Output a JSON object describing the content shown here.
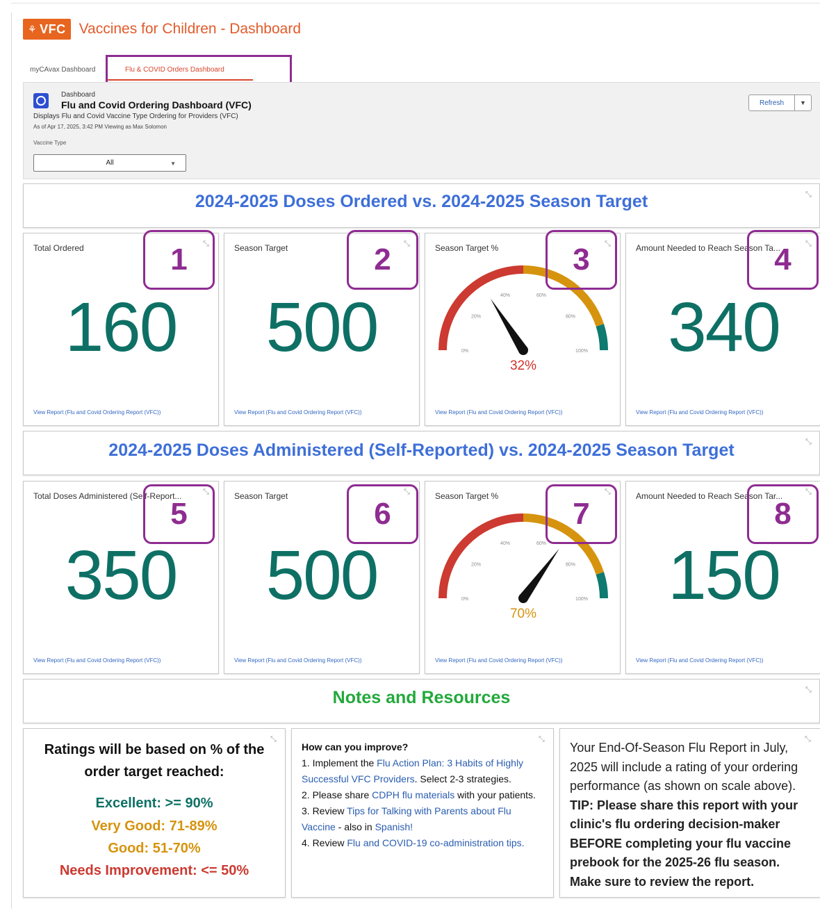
{
  "app": {
    "logo_text": "VFC",
    "logo_glyph": "⚘",
    "title": "Vaccines for Children - Dashboard"
  },
  "tabs": [
    {
      "label": "myCAvax Dashboard",
      "active": false
    },
    {
      "label": "Flu & COVID Orders Dashboard",
      "active": true
    }
  ],
  "dashboard": {
    "kicker": "Dashboard",
    "title": "Flu and Covid Ordering Dashboard (VFC)",
    "description": "Displays Flu and Covid Vaccine Type Ordering for Providers (VFC)",
    "as_of": "As of Apr 17, 2025, 3:42 PM Viewing as Max Solomon",
    "filter_label": "Vaccine Type",
    "filter_value": "All",
    "refresh_label": "Refresh",
    "refresh_menu_glyph": "▼"
  },
  "sections": {
    "ordered_title": "2024-2025 Doses Ordered vs. 2024-2025 Season Target",
    "administered_title": "2024-2025 Doses Administered (Self-Reported) vs. 2024-2025 Season Target",
    "notes_title": "Notes and Resources"
  },
  "colors": {
    "ordered_title": "#3e6fd8",
    "administered_title": "#3e6fd8",
    "notes_title": "#22a93b",
    "metric_value": "#0e7065",
    "gauge_red": "#cc3a31",
    "gauge_orange": "#d6930e",
    "gauge_teal": "#0e7a70",
    "annotation": "#8e2c91"
  },
  "link_text": "View Report (Flu and Covid Ordering Report (VFC))",
  "ordered_cards": [
    {
      "label": "Total Ordered",
      "value": "160"
    },
    {
      "label": "Season Target",
      "value": "500"
    },
    {
      "label": "Season Target %",
      "percent": 32,
      "value_text": "32%",
      "value_color": "#d1312b"
    },
    {
      "label": "Amount Needed to Reach Season Ta...",
      "value": "340"
    }
  ],
  "administered_cards": [
    {
      "label": "Total Doses Administered (Self-Report...",
      "value": "350"
    },
    {
      "label": "Season Target",
      "value": "500"
    },
    {
      "label": "Season Target %",
      "percent": 70,
      "value_text": "70%",
      "value_color": "#d6930e"
    },
    {
      "label": "Amount Needed to Reach Season Tar...",
      "value": "150"
    }
  ],
  "gauge_ticks": [
    "0%",
    "20%",
    "40%",
    "60%",
    "80%",
    "100%"
  ],
  "annotations": [
    "1",
    "2",
    "3",
    "4",
    "5",
    "6",
    "7",
    "8"
  ],
  "ratings": {
    "title": "Ratings will be based on % of the order target reached:",
    "items": [
      {
        "text": "Excellent: >= 90%",
        "color": "#0e7065"
      },
      {
        "text": "Very Good: 71-89%",
        "color": "#d6930e"
      },
      {
        "text": "Good: 51-70%",
        "color": "#d6930e"
      },
      {
        "text": "Needs Improvement: <= 50%",
        "color": "#cc3a31"
      }
    ]
  },
  "improve": {
    "heading": "How can you improve?",
    "i1_pre": "1. Implement the ",
    "i1_link": "Flu Action Plan: 3 Habits of Highly Successful VFC Providers",
    "i1_post": ". Select 2-3 strategies.",
    "i2_pre": "2. Please share ",
    "i2_link": "CDPH flu materials",
    "i2_post": " with your patients.",
    "i3_pre": "3. Review ",
    "i3_link": "Tips for Talking with Parents about Flu Vaccine",
    "i3_mid": " - also in ",
    "i3_link2": "Spanish!",
    "i4_pre": "4. Review ",
    "i4_link": "Flu and COVID-19 co-administration tips."
  },
  "report": {
    "text": "Your End-Of-Season Flu Report in July, 2025 will include a rating of your ordering performance (as shown on scale above).",
    "tip": "TIP: Please share this report with your clinic's flu ordering decision-maker BEFORE completing your flu vaccine prebook for the 2025-26 flu season. Make sure to review the report."
  },
  "icons": {
    "expand": "expand-icon",
    "dashboard": "dashboard-icon",
    "chevron": "chevron-down-icon"
  }
}
